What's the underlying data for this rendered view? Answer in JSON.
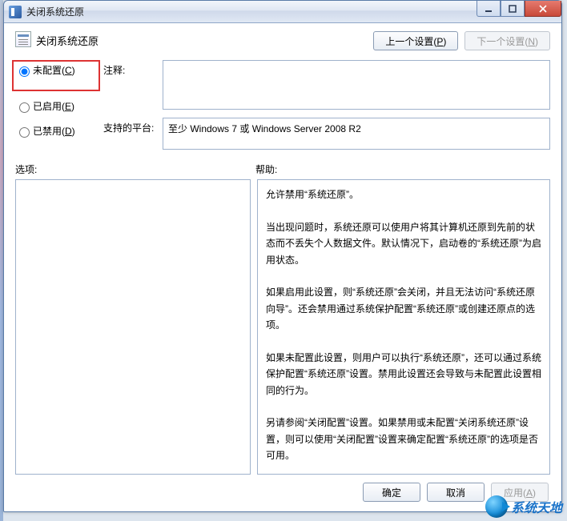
{
  "window": {
    "title": "关闭系统还原"
  },
  "header": {
    "title": "关闭系统还原",
    "prev_btn": "上一个设置(P)",
    "next_btn": "下一个设置(N)"
  },
  "radios": {
    "not_configured": "未配置(C)",
    "enabled": "已启用(E)",
    "disabled": "已禁用(D)",
    "selected": "not_configured"
  },
  "fields": {
    "comment_label": "注释:",
    "comment_value": "",
    "platform_label": "支持的平台:",
    "platform_value": "至少 Windows 7 或 Windows Server 2008 R2"
  },
  "labels": {
    "options": "选项:",
    "help": "帮助:"
  },
  "help_text": "允许禁用“系统还原”。\n\n当出现问题时，系统还原可以使用户将其计算机还原到先前的状态而不丢失个人数据文件。默认情况下，启动卷的“系统还原”为启用状态。\n\n如果启用此设置，则“系统还原”会关闭，并且无法访问“系统还原向导”。还会禁用通过系统保护配置“系统还原”或创建还原点的选项。\n\n如果未配置此设置，则用户可以执行“系统还原”，还可以通过系统保护配置“系统还原”设置。禁用此设置还会导致与未配置此设置相同的行为。\n\n另请参阅“关闭配置”设置。如果禁用或未配置“关闭系统还原”设置，则可以使用“关闭配置”设置来确定配置“系统还原”的选项是否可用。",
  "footer": {
    "ok": "确定",
    "cancel": "取消",
    "apply": "应用(A)"
  },
  "watermark": "系统天地"
}
